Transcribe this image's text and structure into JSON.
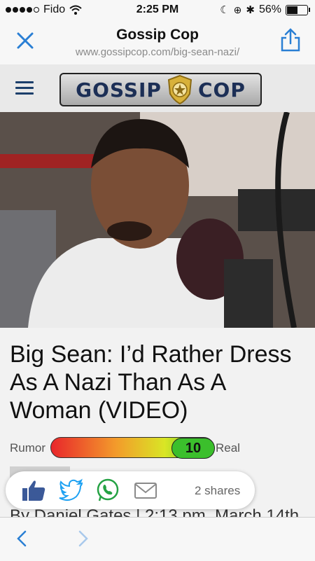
{
  "status": {
    "carrier": "Fido",
    "time": "2:25 PM",
    "battery_percent": "56%",
    "battery_level": 0.56
  },
  "navbar": {
    "title": "Gossip Cop",
    "url": "www.gossipcop.com/big-sean-nazi/"
  },
  "site": {
    "logo_left": "GOSSIP",
    "logo_right": "COP"
  },
  "article": {
    "headline": "Big Sean: I’d Rather Dress As A Nazi Than As A Woman (VIDEO)",
    "meter": {
      "left_label": "Rumor",
      "score": "10",
      "right_label": "Real",
      "score_fraction": 1.0
    },
    "byline": "By Daniel Gates | 2:13 pm, March 14th,"
  },
  "share_bar": {
    "shares": "2 shares",
    "icons": [
      "facebook-like-icon",
      "twitter-icon",
      "whatsapp-icon",
      "email-icon"
    ]
  },
  "colors": {
    "accent": "#2a7fd4",
    "logo_text": "#1c2f56",
    "meter_high": "#3bbf2c"
  }
}
